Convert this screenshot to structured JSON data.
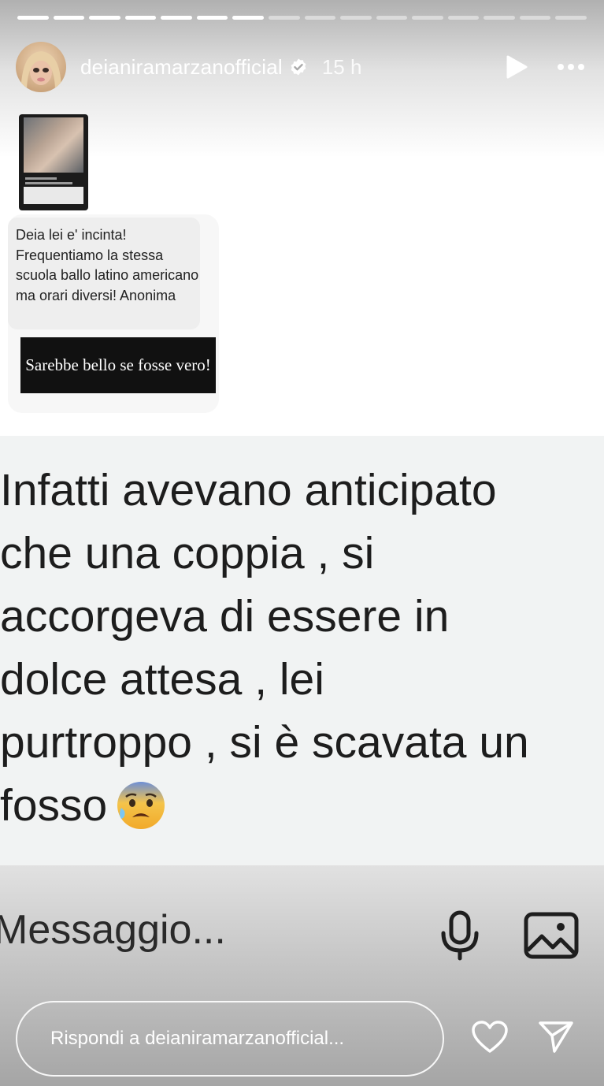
{
  "story": {
    "progress": {
      "total_segments": 16,
      "completed_segments": 7
    },
    "header": {
      "username": "deianiramarzanofficial",
      "time": "15 h",
      "verified": true,
      "play_icon": "play-icon",
      "more_icon": "more-icon"
    },
    "question_card": {
      "text": "Deia lei e' incinta! Frequentiamo la stessa scuola ballo latino americano ma orari diversi! Anonima",
      "answer": "Sarebbe bello se fosse vero!"
    },
    "main_text": {
      "lines": [
        "Infatti avevano anticipato",
        "che una coppia , si",
        "accorgeva di essere in",
        "dolce attesa , lei",
        "purtroppo , si è scavata un",
        "fosso"
      ],
      "emoji": "anxious-face-with-sweat-emoji"
    },
    "composer": {
      "placeholder": "Messaggio...",
      "mic_icon": "microphone-icon",
      "gallery_icon": "image-icon"
    },
    "reply": {
      "placeholder": "Rispondi a deianiramarzanofficial...",
      "like_icon": "heart-icon",
      "send_icon": "send-icon"
    }
  }
}
